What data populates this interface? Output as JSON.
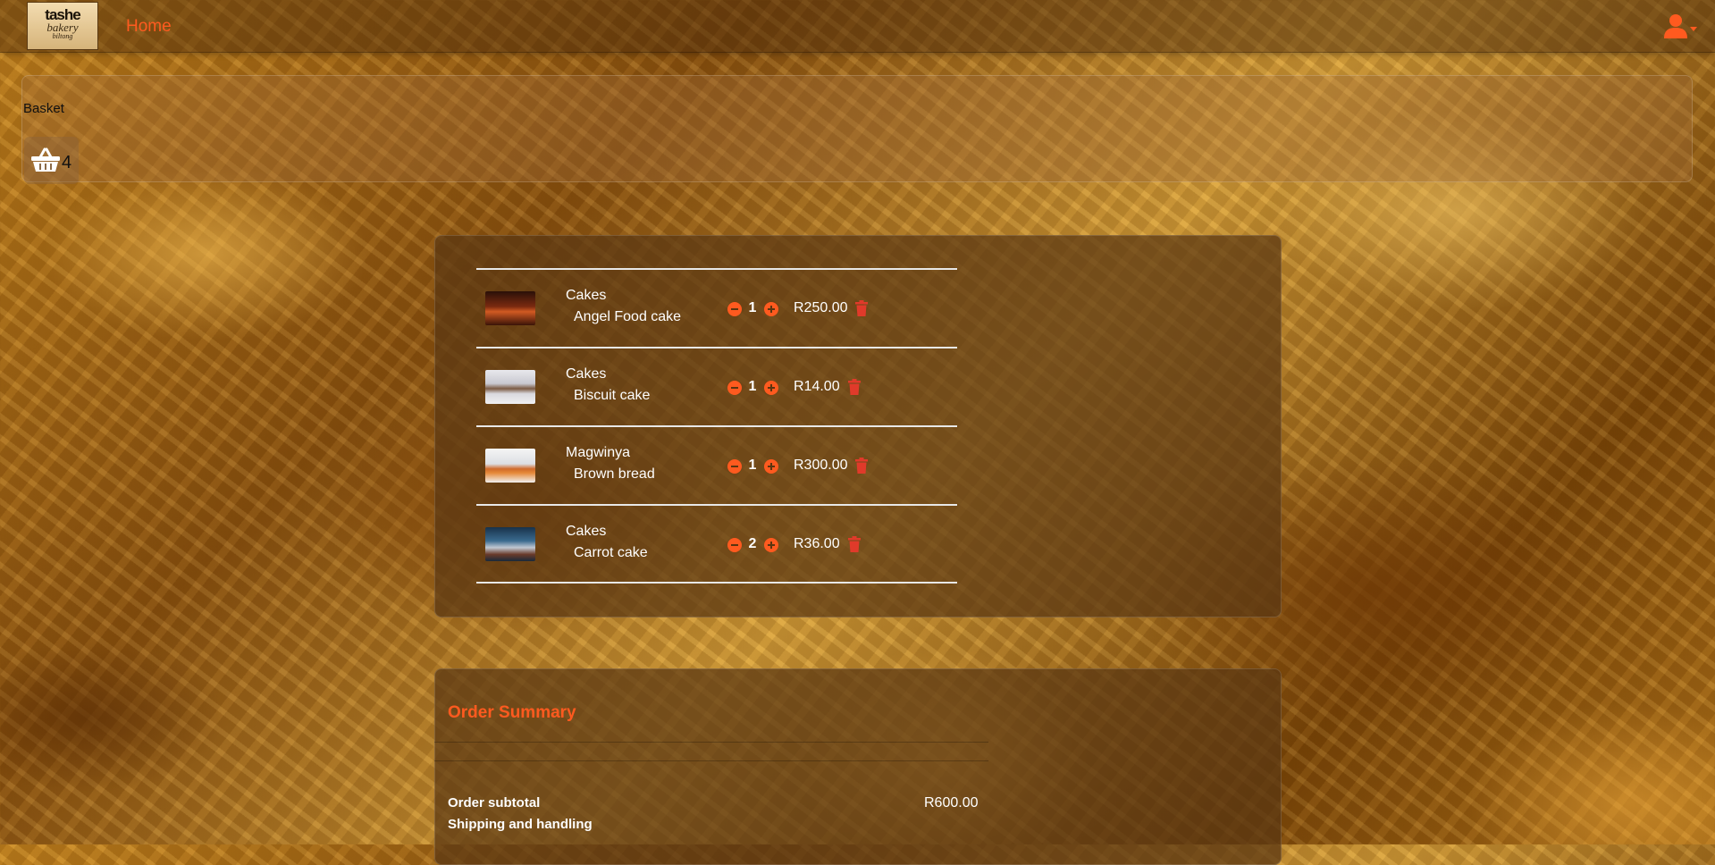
{
  "navbar": {
    "logo": {
      "line1": "tashe",
      "line2": "bakery",
      "line3": "biltong"
    },
    "home_label": "Home"
  },
  "basket": {
    "title": "Basket",
    "count": "4"
  },
  "cart": {
    "items": [
      {
        "category": "Cakes",
        "name": "Angel Food cake",
        "qty": "1",
        "price": "R250.00"
      },
      {
        "category": "Cakes",
        "name": "Biscuit cake",
        "qty": "1",
        "price": "R14.00"
      },
      {
        "category": "Magwinya",
        "name": "Brown bread",
        "qty": "1",
        "price": "R300.00"
      },
      {
        "category": "Cakes",
        "name": "Carrot cake",
        "qty": "2",
        "price": "R36.00"
      }
    ]
  },
  "summary": {
    "title": "Order Summary",
    "subtotal_label": "Order subtotal",
    "subtotal_value": "R600.00",
    "shipping_label": "Shipping and handling"
  },
  "colors": {
    "accent": "#ff5a1f",
    "delete": "#e03a2a"
  },
  "icons": [
    "user-icon",
    "caret-down-icon",
    "basket-icon",
    "minus-circle-icon",
    "plus-circle-icon",
    "trash-icon"
  ]
}
